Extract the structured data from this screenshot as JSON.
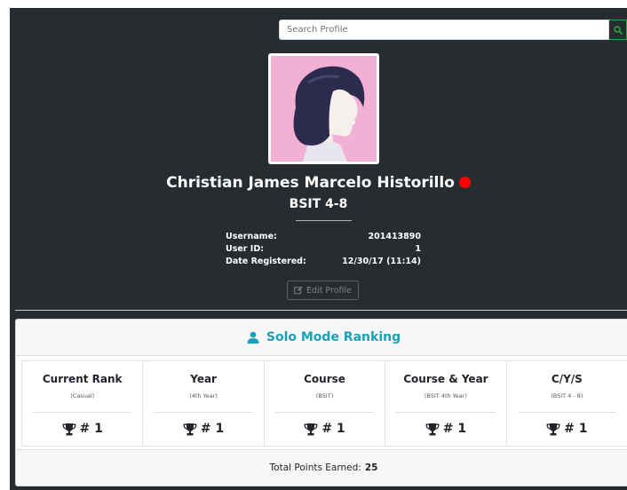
{
  "search": {
    "placeholder": "Search Profile"
  },
  "profile": {
    "name": "Christian James Marcelo Historillo",
    "section": "BSIT 4-8",
    "status_color": "#ff0000",
    "info": [
      {
        "label": "Username:",
        "value": "201413890"
      },
      {
        "label": "User ID:",
        "value": "1"
      },
      {
        "label": "Date Registered:",
        "value": "12/30/17 (11:14)"
      }
    ],
    "edit_label": "Edit Profile"
  },
  "ranking": {
    "title": "Solo Mode Ranking",
    "accent": "#17a2b8",
    "columns": [
      {
        "title": "Current Rank",
        "sub": "(Casual)",
        "value": "# 1"
      },
      {
        "title": "Year",
        "sub": "(4th Year)",
        "value": "# 1"
      },
      {
        "title": "Course",
        "sub": "(BSIT)",
        "value": "# 1"
      },
      {
        "title": "Course & Year",
        "sub": "(BSIT 4th Year)",
        "value": "# 1"
      },
      {
        "title": "C/Y/S",
        "sub": "(BSIT 4 - 8)",
        "value": "# 1"
      }
    ],
    "points_label": "Total Points Earned:",
    "points_value": "25"
  }
}
